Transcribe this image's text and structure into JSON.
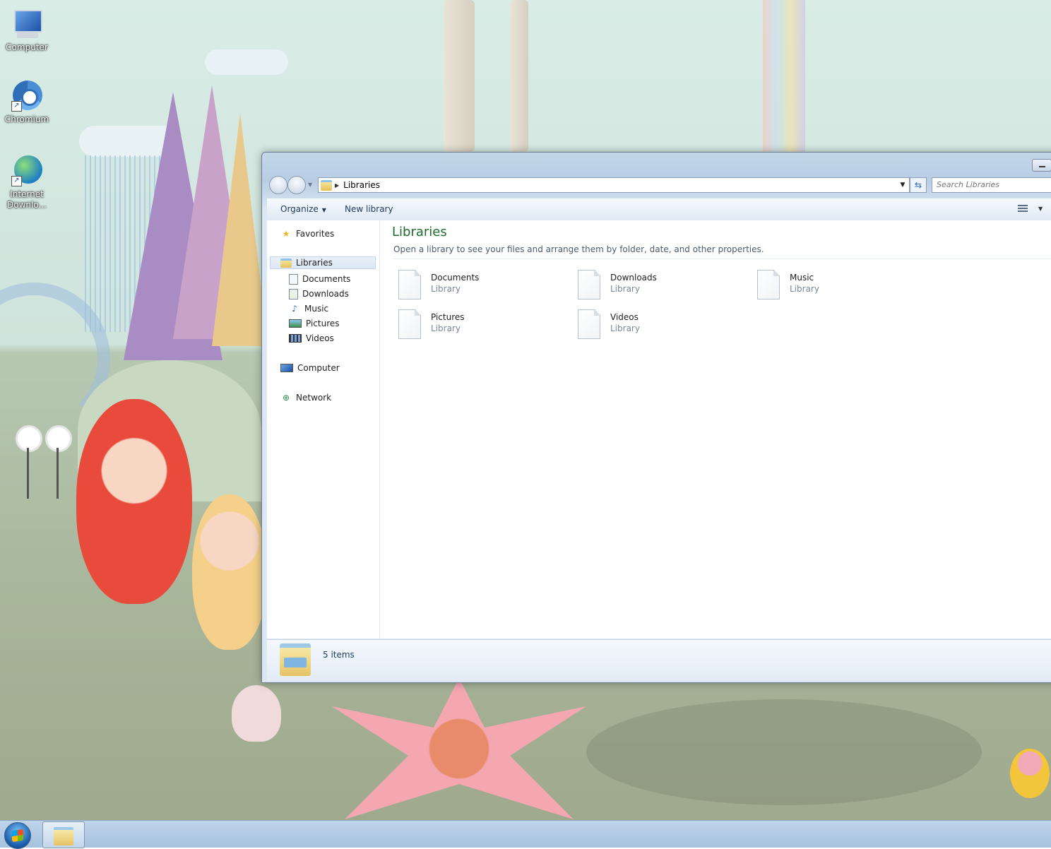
{
  "desktop": {
    "icons": [
      {
        "label": "Computer"
      },
      {
        "label": "Chromium"
      },
      {
        "label": "Internet Downlo..."
      }
    ]
  },
  "explorer": {
    "address": {
      "segment": "Libraries"
    },
    "search": {
      "placeholder": "Search Libraries"
    },
    "toolbar": {
      "organize_label": "Organize",
      "new_library_label": "New library"
    },
    "nav_pane": {
      "favorites": "Favorites",
      "libraries": "Libraries",
      "library_items": [
        "Documents",
        "Downloads",
        "Music",
        "Pictures",
        "Videos"
      ],
      "computer": "Computer",
      "network": "Network"
    },
    "content": {
      "title": "Libraries",
      "subtitle": "Open a library to see your files and arrange them by folder, date, and other properties.",
      "items": [
        {
          "name": "Documents",
          "type": "Library"
        },
        {
          "name": "Downloads",
          "type": "Library"
        },
        {
          "name": "Music",
          "type": "Library"
        },
        {
          "name": "Pictures",
          "type": "Library"
        },
        {
          "name": "Videos",
          "type": "Library"
        }
      ]
    },
    "details": {
      "count_text": "5 items"
    }
  },
  "theme": {
    "accent_title": "#1e6b2e",
    "window_frame": "#c3d7ea",
    "taskbar": "#a7c2de"
  }
}
